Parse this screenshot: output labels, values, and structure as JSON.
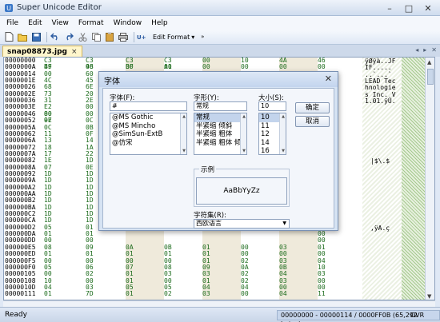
{
  "window": {
    "title": "Super Unicode Editor"
  },
  "menu": [
    "File",
    "Edit",
    "View",
    "Format",
    "Window",
    "Help"
  ],
  "toolbar": {
    "format_label": "Edit Format"
  },
  "tab": {
    "label": "snap08873.jpg",
    "close": "×"
  },
  "hex": {
    "offsets": [
      "00000000",
      "0000000A",
      "00000014",
      "0000001E",
      "00000028",
      "00000032",
      "0000003C",
      "00000046",
      "00000050",
      "0000005A",
      "00000064",
      "0000006E",
      "00000078",
      "00000082",
      "0000008C",
      "00000096",
      "000000A0",
      "000000AA",
      "000000B4",
      "000000BE",
      "000000C8",
      "000000D2",
      "000000DC",
      "000000E6",
      "000000F0",
      "000000FA",
      "00000104",
      "0000010E",
      "00000118",
      "00000122",
      "0000012C",
      "00000136",
      "00000140",
      "0000014A",
      "00000154",
      "0000015E"
    ],
    "rows": [
      [
        "00000000",
        "C3 BF",
        "C3 98",
        "C3 BF",
        "C3 A0",
        "00",
        "10",
        "4A",
        "46"
      ],
      [
        "0000000A",
        "49",
        "46",
        "00",
        "01",
        "00",
        "00",
        "00",
        "00"
      ],
      [
        "00000014",
        "00",
        "60",
        "",
        "",
        "",
        "",
        "",
        "60"
      ],
      [
        "0000001E",
        "4C",
        "45",
        "",
        "",
        "",
        "",
        "",
        "20"
      ],
      [
        "00000026",
        "68",
        "6E",
        "",
        "",
        "",
        "",
        "",
        "68"
      ],
      [
        "0000002E",
        "73",
        "20",
        "",
        "",
        "",
        "",
        "",
        "2E"
      ],
      [
        "00000036",
        "31",
        "2E",
        "",
        "",
        "",
        "",
        "",
        "00"
      ],
      [
        "0000003E",
        "E2 80 9E",
        "00",
        "",
        "",
        "",
        "",
        "",
        "00"
      ],
      [
        "00000046",
        "00",
        "00",
        "",
        "",
        "",
        "",
        "",
        "00"
      ],
      [
        "00000052",
        "07",
        "0C",
        "",
        "",
        "",
        "",
        "",
        "07"
      ],
      [
        "0000005A",
        "0C",
        "0B",
        "",
        "",
        "",
        "",
        "",
        "0A"
      ],
      [
        "00000062",
        "11",
        "0F",
        "",
        "",
        "",
        "",
        "",
        "11"
      ],
      [
        "0000006A",
        "13",
        "14",
        "",
        "",
        "",
        "",
        "",
        "15"
      ],
      [
        "00000072",
        "18",
        "1A",
        "",
        "",
        "",
        "",
        "",
        "1C"
      ],
      [
        "0000007A",
        "17",
        "22",
        "",
        "",
        "",
        "",
        "",
        "1F"
      ],
      [
        "00000082",
        "1E",
        "1D",
        "",
        "",
        "",
        "",
        "",
        "1E"
      ],
      [
        "0000008A",
        "07",
        "0E",
        "",
        "",
        "",
        "",
        "",
        "1D"
      ],
      [
        "00000092",
        "1D",
        "1D",
        "",
        "",
        "",
        "",
        "",
        "1D"
      ],
      [
        "0000009A",
        "1D",
        "1D",
        "",
        "",
        "",
        "",
        "",
        "1D"
      ],
      [
        "000000A2",
        "1D",
        "1D",
        "",
        "",
        "",
        "",
        "",
        "1D"
      ],
      [
        "000000AA",
        "1D",
        "1D",
        "",
        "",
        "",
        "",
        "",
        "1D"
      ],
      [
        "000000B2",
        "1D",
        "1D",
        "",
        "",
        "",
        "",
        "",
        "1D"
      ],
      [
        "000000BA",
        "1D",
        "1D",
        "",
        "",
        "",
        "",
        "",
        "1D"
      ],
      [
        "000000C2",
        "1D",
        "1D",
        "",
        "",
        "",
        "",
        "",
        "1D"
      ],
      [
        "000000CA",
        "1D",
        "1D",
        "",
        "",
        "",
        "",
        "",
        "1D"
      ],
      [
        "000000D2",
        "05",
        "01",
        "",
        "",
        "",
        "",
        "",
        "C3"
      ],
      [
        "000000DA",
        "01",
        "01",
        "",
        "",
        "",
        "",
        "",
        "00"
      ],
      [
        "000000DD",
        "00",
        "00",
        "",
        "",
        "",
        "",
        "",
        "00"
      ],
      [
        "000000E5",
        "08",
        "09",
        "0A",
        "0B",
        "01",
        "00",
        "03",
        "01"
      ],
      [
        "000000ED",
        "01",
        "01",
        "01",
        "01",
        "01",
        "00",
        "00",
        "00"
      ],
      [
        "000000F5",
        "00",
        "00",
        "00",
        "00",
        "01",
        "02",
        "03",
        "04"
      ],
      [
        "000000F0",
        "05",
        "06",
        "07",
        "08",
        "09",
        "0A",
        "0B",
        "10"
      ],
      [
        "00000105",
        "00",
        "02",
        "01",
        "03",
        "03",
        "02",
        "04",
        "03"
      ],
      [
        "00000108",
        "10",
        "00",
        "01",
        "00",
        "01",
        "02",
        "03",
        "00"
      ],
      [
        "0000010D",
        "04",
        "03",
        "05",
        "05",
        "04",
        "04",
        "00",
        "00"
      ],
      [
        "00000111",
        "01",
        "7D",
        "01",
        "02",
        "03",
        "00",
        "04",
        "11"
      ]
    ],
    "ascii": [
      "ÿØÿà..JF",
      "IF.....",
      "..`...`",
      "LEAD Tec",
      "hnologie",
      "s Inc. V",
      "1.01.ÿÛ.",
      "",
      "",
      "",
      "",
      "",
      "",
      "",
      "",
      "",
      "",
      "",
      "",
      "",
      "",
      "",
      "",
      "",
      "",
      "",
      "",
      "",
      "",
      "",
      "",
      "",
      "",
      "",
      "",
      ""
    ],
    "ascii_extra": {
      "row_15": "|$\\.$",
      "row_25": ",ÿA.ç"
    }
  },
  "dialog": {
    "title": "字体",
    "font_label": "字体(F):",
    "font_value": "#",
    "fonts": [
      "@MS Gothic",
      "@MS Mincho",
      "@SimSun-ExtB",
      "@仿宋"
    ],
    "style_label": "字形(Y):",
    "style_value": "常规",
    "styles": [
      "常规",
      "半紧缩 倾斜",
      "半紧缩 粗体",
      "半紧缩 粗体 倾"
    ],
    "size_label": "大小(S):",
    "size_value": "10",
    "sizes": [
      "10",
      "11",
      "12",
      "14",
      "16",
      "18",
      "20"
    ],
    "ok": "确定",
    "cancel": "取消",
    "sample_label": "示例",
    "sample_text": "AaBbYyZz",
    "charset_label": "字符集(R):",
    "charset_value": "西欧语言"
  },
  "status": {
    "ready": "Ready",
    "position": "00000000 - 00000114 / 0000FF0B (65,292 bytes)",
    "mode": "OVR"
  }
}
